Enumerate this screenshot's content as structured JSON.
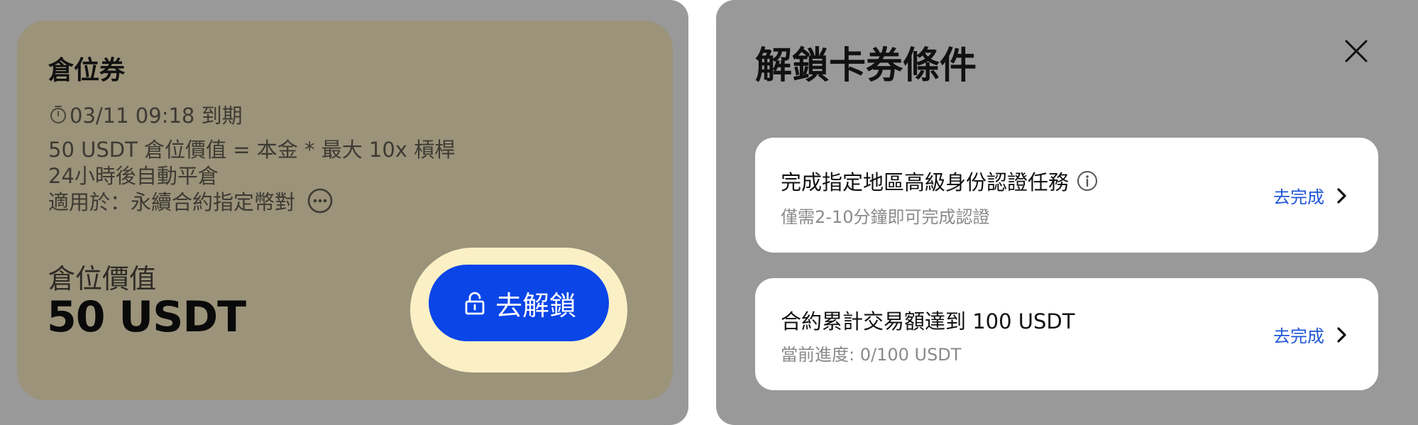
{
  "coupon": {
    "title": "倉位券",
    "expiry": "03/11 09:18 到期",
    "desc_1": "50 USDT 倉位價值 = 本金 * 最大 10x 槓桿",
    "desc_2": "24小時後自動平倉",
    "desc_3": "適用於：永續合約指定幣對",
    "value_label": "倉位價值",
    "value_amount": "50 USDT",
    "unlock_label": "去解鎖"
  },
  "sheet": {
    "title": "解鎖卡券條件",
    "tasks": [
      {
        "title": "完成指定地區高級身份認證任務",
        "subtitle": "僅需2-10分鐘即可完成認證",
        "action": "去完成"
      },
      {
        "title": "合約累計交易額達到 100 USDT",
        "subtitle": "當前進度: 0/100 USDT",
        "action": "去完成"
      }
    ]
  },
  "icons": [
    "timer-icon",
    "more-icon",
    "lock-icon",
    "close-icon",
    "info-icon",
    "chevron-right-icon"
  ],
  "colors": {
    "overlay": "#999999",
    "card_tint": "#9b937a",
    "unlock_halo": "#fbf0c5",
    "primary": "#0a45e8",
    "link": "#1f55d6"
  }
}
